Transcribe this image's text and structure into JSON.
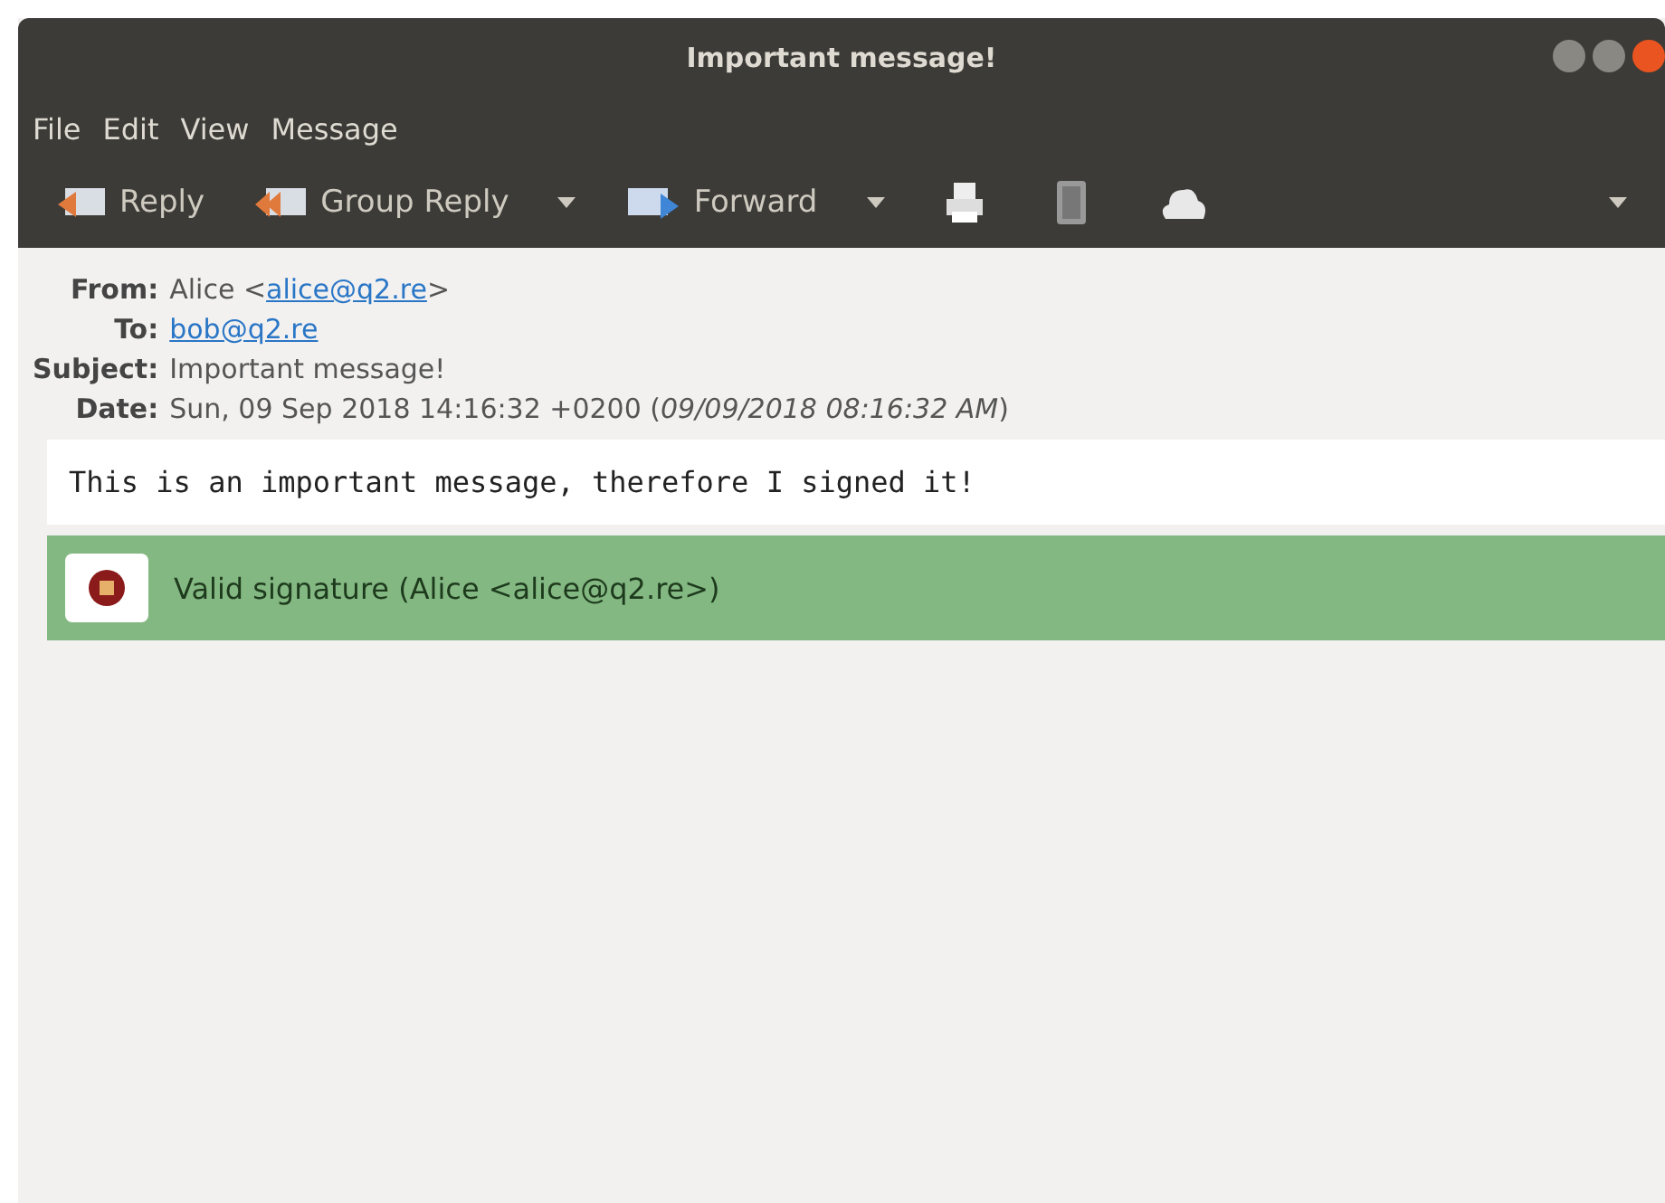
{
  "window": {
    "title": "Important message!"
  },
  "menu": [
    "File",
    "Edit",
    "View",
    "Message"
  ],
  "toolbar": [
    {
      "kind": "button",
      "label": "Reply"
    },
    {
      "kind": "button",
      "label": "Group Reply"
    },
    {
      "kind": "dropdown"
    },
    {
      "kind": "button",
      "label": "Forward"
    },
    {
      "kind": "dropdown"
    },
    {
      "kind": "icon"
    },
    {
      "kind": "icon"
    },
    {
      "kind": "icon"
    },
    {
      "kind": "overflow"
    }
  ],
  "headers": [
    {
      "label": "From:",
      "parts": [
        {
          "kind": "text",
          "text": "Alice <"
        },
        {
          "kind": "link",
          "text": "alice@q2.re"
        },
        {
          "kind": "text",
          "text": ">"
        }
      ]
    },
    {
      "label": "To:",
      "parts": [
        {
          "kind": "link",
          "text": "bob@q2.re"
        }
      ]
    },
    {
      "label": "Subject:",
      "parts": [
        {
          "kind": "text",
          "text": "Important message!"
        }
      ]
    },
    {
      "label": "Date:",
      "parts": [
        {
          "kind": "text",
          "text": "Sun, 09 Sep 2018 14:16:32 +0200 (*09/09/2018 08:16:32 AM*)"
        }
      ]
    }
  ],
  "body": "This is an important message, therefore I signed it!",
  "signature": {
    "text": "Valid signature (Alice <alice@q2.re>)",
    "color": "#84b882"
  }
}
